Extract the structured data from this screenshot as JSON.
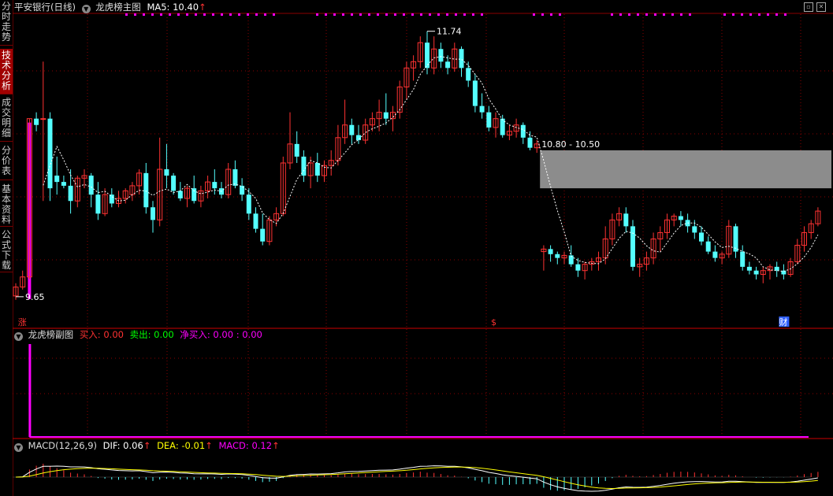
{
  "sidebar": {
    "tabs": [
      {
        "label": "分时走势",
        "active": false
      },
      {
        "label": "技术分析",
        "active": true
      },
      {
        "label": "成交明细",
        "active": false
      },
      {
        "label": "分价表",
        "active": false
      },
      {
        "label": "基本资料",
        "active": false
      },
      {
        "label": "公式下载",
        "active": false
      }
    ]
  },
  "main_header": {
    "stock_title": "平安银行(日线)",
    "indicator_name": "龙虎榜主图",
    "ma_label": "MA5: 10.40",
    "ma_arrow": "↑"
  },
  "annotations": {
    "high_label": "11.74",
    "low_label": "9.65",
    "zone_label": "10.80 - 10.50",
    "markers": [
      "涨",
      "$",
      "财"
    ]
  },
  "sub_panel": {
    "title": "龙虎榜副图",
    "buy": "买入: 0.00",
    "sell": "卖出: 0.00",
    "net": "净买入: 0.00 : 0.00"
  },
  "macd_panel": {
    "title": "MACD(12,26,9)",
    "dif": "DIF: 0.06",
    "dea": "DEA: -0.01",
    "macd": "MACD: 0.12",
    "arrow": "↑"
  },
  "colors": {
    "up": "#ff3232",
    "down": "#54ffff",
    "ma": "#ffffff",
    "magenta": "#ff00ff",
    "zone": "#8c8c8c",
    "grid": "#8b0000",
    "dea": "#ffff00"
  },
  "chart_data": {
    "type": "candlestick",
    "price_axis_range": [
      9.5,
      11.85
    ],
    "candles_ohlc": [
      [
        9.65,
        9.75,
        9.62,
        9.72
      ],
      [
        9.72,
        9.85,
        9.7,
        9.8
      ],
      [
        9.8,
        11.05,
        9.78,
        11.05
      ],
      [
        11.05,
        11.1,
        10.95,
        11.0
      ],
      [
        11.05,
        11.5,
        10.4,
        11.05
      ],
      [
        11.05,
        11.1,
        10.4,
        10.5
      ],
      [
        10.6,
        10.75,
        10.45,
        10.55
      ],
      [
        10.55,
        10.6,
        10.5,
        10.52
      ],
      [
        10.52,
        10.65,
        10.3,
        10.4
      ],
      [
        10.4,
        10.6,
        10.35,
        10.58
      ],
      [
        10.58,
        10.65,
        10.5,
        10.6
      ],
      [
        10.6,
        10.62,
        10.35,
        10.45
      ],
      [
        10.45,
        10.55,
        10.25,
        10.3
      ],
      [
        10.3,
        10.5,
        10.28,
        10.45
      ],
      [
        10.45,
        10.5,
        10.35,
        10.38
      ],
      [
        10.38,
        10.48,
        10.35,
        10.42
      ],
      [
        10.42,
        10.5,
        10.38,
        10.48
      ],
      [
        10.45,
        10.55,
        10.4,
        10.52
      ],
      [
        10.52,
        10.65,
        10.45,
        10.62
      ],
      [
        10.62,
        10.7,
        10.3,
        10.35
      ],
      [
        10.35,
        10.4,
        10.15,
        10.25
      ],
      [
        10.25,
        10.9,
        10.2,
        10.65
      ],
      [
        10.65,
        10.85,
        10.5,
        10.6
      ],
      [
        10.6,
        10.62,
        10.45,
        10.48
      ],
      [
        10.48,
        10.55,
        10.4,
        10.42
      ],
      [
        10.42,
        10.52,
        10.35,
        10.5
      ],
      [
        10.5,
        10.6,
        10.38,
        10.4
      ],
      [
        10.4,
        10.52,
        10.35,
        10.48
      ],
      [
        10.48,
        10.6,
        10.42,
        10.55
      ],
      [
        10.55,
        10.65,
        10.45,
        10.5
      ],
      [
        10.5,
        10.55,
        10.42,
        10.45
      ],
      [
        10.45,
        10.7,
        10.42,
        10.65
      ],
      [
        10.65,
        10.72,
        10.5,
        10.52
      ],
      [
        10.52,
        10.58,
        10.4,
        10.45
      ],
      [
        10.45,
        10.5,
        10.25,
        10.3
      ],
      [
        10.3,
        10.35,
        10.15,
        10.18
      ],
      [
        10.18,
        10.3,
        10.05,
        10.08
      ],
      [
        10.08,
        10.28,
        10.05,
        10.25
      ],
      [
        10.25,
        10.35,
        10.2,
        10.3
      ],
      [
        10.3,
        10.75,
        10.28,
        10.7
      ],
      [
        10.7,
        11.1,
        10.65,
        10.85
      ],
      [
        10.85,
        10.95,
        10.7,
        10.75
      ],
      [
        10.75,
        10.8,
        10.55,
        10.6
      ],
      [
        10.6,
        10.75,
        10.5,
        10.7
      ],
      [
        10.7,
        10.78,
        10.55,
        10.6
      ],
      [
        10.6,
        10.72,
        10.55,
        10.68
      ],
      [
        10.68,
        10.8,
        10.6,
        10.72
      ],
      [
        10.72,
        11.0,
        10.68,
        10.9
      ],
      [
        10.9,
        11.2,
        10.85,
        11.0
      ],
      [
        11.0,
        11.05,
        10.85,
        10.92
      ],
      [
        10.92,
        11.0,
        10.85,
        10.88
      ],
      [
        10.88,
        11.05,
        10.85,
        11.0
      ],
      [
        11.0,
        11.1,
        10.95,
        11.05
      ],
      [
        11.05,
        11.2,
        10.95,
        11.1
      ],
      [
        11.1,
        11.25,
        11.0,
        11.05
      ],
      [
        11.05,
        11.15,
        10.95,
        11.1
      ],
      [
        11.1,
        11.35,
        11.05,
        11.3
      ],
      [
        11.3,
        11.5,
        11.2,
        11.45
      ],
      [
        11.45,
        11.55,
        11.35,
        11.5
      ],
      [
        11.5,
        11.7,
        11.45,
        11.65
      ],
      [
        11.65,
        11.74,
        11.4,
        11.45
      ],
      [
        11.45,
        11.7,
        11.4,
        11.6
      ],
      [
        11.6,
        11.65,
        11.45,
        11.5
      ],
      [
        11.5,
        11.55,
        11.4,
        11.45
      ],
      [
        11.45,
        11.65,
        11.42,
        11.6
      ],
      [
        11.6,
        11.62,
        11.38,
        11.45
      ],
      [
        11.45,
        11.5,
        11.3,
        11.35
      ],
      [
        11.35,
        11.4,
        11.1,
        11.15
      ],
      [
        11.15,
        11.25,
        11.05,
        11.1
      ],
      [
        11.1,
        11.15,
        10.95,
        10.98
      ],
      [
        10.98,
        11.1,
        10.9,
        11.05
      ],
      [
        11.05,
        11.08,
        10.9,
        10.92
      ],
      [
        10.92,
        11.0,
        10.88,
        10.95
      ],
      [
        10.95,
        11.05,
        10.9,
        11.0
      ],
      [
        11.0,
        11.02,
        10.85,
        10.9
      ],
      [
        10.9,
        10.95,
        10.8,
        10.82
      ],
      [
        10.82,
        10.88,
        10.78,
        10.85
      ],
      [
        10.0,
        10.05,
        9.85,
        10.02
      ],
      [
        10.02,
        10.05,
        9.92,
        9.98
      ],
      [
        9.98,
        10.0,
        9.9,
        9.95
      ],
      [
        9.95,
        10.0,
        9.9,
        9.97
      ],
      [
        9.97,
        10.05,
        9.88,
        9.9
      ],
      [
        9.9,
        9.95,
        9.8,
        9.85
      ],
      [
        9.85,
        9.92,
        9.78,
        9.9
      ],
      [
        9.9,
        9.95,
        9.85,
        9.92
      ],
      [
        9.92,
        10.0,
        9.85,
        9.95
      ],
      [
        9.95,
        10.2,
        9.9,
        10.1
      ],
      [
        10.1,
        10.3,
        10.05,
        10.25
      ],
      [
        10.25,
        10.35,
        10.2,
        10.3
      ],
      [
        10.3,
        10.35,
        10.15,
        10.2
      ],
      [
        10.2,
        10.25,
        9.85,
        9.88
      ],
      [
        9.88,
        9.95,
        9.8,
        9.9
      ],
      [
        9.9,
        10.0,
        9.85,
        9.95
      ],
      [
        9.95,
        10.15,
        9.9,
        10.1
      ],
      [
        10.1,
        10.2,
        10.0,
        10.15
      ],
      [
        10.15,
        10.3,
        10.1,
        10.25
      ],
      [
        10.25,
        10.3,
        10.2,
        10.28
      ],
      [
        10.28,
        10.32,
        10.2,
        10.25
      ],
      [
        10.25,
        10.3,
        10.15,
        10.2
      ],
      [
        10.2,
        10.25,
        10.1,
        10.15
      ],
      [
        10.15,
        10.2,
        10.05,
        10.08
      ],
      [
        10.08,
        10.12,
        9.98,
        10.0
      ],
      [
        10.0,
        10.05,
        9.92,
        9.95
      ],
      [
        9.95,
        10.0,
        9.9,
        9.98
      ],
      [
        9.98,
        10.25,
        9.95,
        10.2
      ],
      [
        10.2,
        10.22,
        9.95,
        10.0
      ],
      [
        10.0,
        10.05,
        9.85,
        9.88
      ],
      [
        9.88,
        9.92,
        9.82,
        9.85
      ],
      [
        9.85,
        9.88,
        9.78,
        9.82
      ],
      [
        9.82,
        9.88,
        9.75,
        9.85
      ],
      [
        9.85,
        9.9,
        9.78,
        9.88
      ],
      [
        9.88,
        9.92,
        9.8,
        9.85
      ],
      [
        9.85,
        9.9,
        9.78,
        9.82
      ],
      [
        9.82,
        9.95,
        9.8,
        9.92
      ],
      [
        9.92,
        10.1,
        9.9,
        10.05
      ],
      [
        10.05,
        10.2,
        10.0,
        10.15
      ],
      [
        10.15,
        10.25,
        10.1,
        10.22
      ],
      [
        10.22,
        10.35,
        10.2,
        10.32
      ]
    ],
    "ma5_label_value": 10.4,
    "high_value": 11.74,
    "low_value": 9.65,
    "zone_range": [
      10.5,
      10.8
    ],
    "macd_dif_last": 0.06,
    "macd_dea_last": -0.01,
    "macd_hist_last": 0.12
  }
}
